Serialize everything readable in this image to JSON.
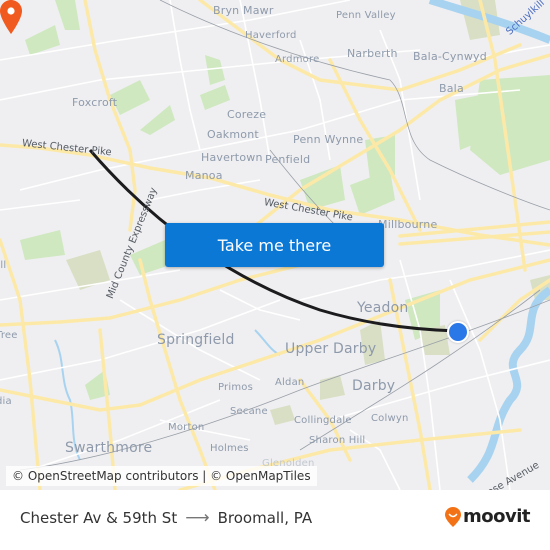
{
  "map": {
    "places": [
      {
        "name": "Bryn Mawr",
        "size": "s10"
      },
      {
        "name": "Penn Valley",
        "size": "s9"
      },
      {
        "name": "Haverford",
        "size": "s9"
      },
      {
        "name": "Ardmore",
        "size": "s9"
      },
      {
        "name": "Narberth",
        "size": "s10"
      },
      {
        "name": "Bala-Cynwyd",
        "size": "s10"
      },
      {
        "name": "Bala",
        "size": "s10"
      },
      {
        "name": "Foxcroft",
        "size": "s10"
      },
      {
        "name": "Coreze",
        "size": "s10"
      },
      {
        "name": "Oakmont",
        "size": "s10"
      },
      {
        "name": "Penn Wynne",
        "size": "s10"
      },
      {
        "name": "Havertown",
        "size": "s10"
      },
      {
        "name": "Penfield",
        "size": "s10"
      },
      {
        "name": "Manoa",
        "size": "s10"
      },
      {
        "name": "Millbourne",
        "size": "s10"
      },
      {
        "name": "Yeadon",
        "size": "s12"
      },
      {
        "name": "Springfield",
        "size": "s12"
      },
      {
        "name": "Upper Darby",
        "size": "s12"
      },
      {
        "name": "Darby",
        "size": "s12"
      },
      {
        "name": "Primos",
        "size": "s9"
      },
      {
        "name": "Aldan",
        "size": "s9"
      },
      {
        "name": "Secane",
        "size": "s9"
      },
      {
        "name": "Collingdale",
        "size": "s9"
      },
      {
        "name": "Colwyn",
        "size": "s9"
      },
      {
        "name": "Morton",
        "size": "s9"
      },
      {
        "name": "Holmes",
        "size": "s9"
      },
      {
        "name": "Sharon Hill",
        "size": "s9"
      },
      {
        "name": "Swarthmore",
        "size": "s12"
      },
      {
        "name": "Glenolden",
        "size": "s9"
      },
      {
        "name": "ell",
        "size": "s9"
      },
      {
        "name": "Tree",
        "size": "s9"
      },
      {
        "name": "dia",
        "size": "s9"
      }
    ],
    "roads": {
      "west_chester_pike_west": "West Chester Pike",
      "west_chester_pike_east": "West Chester Pike",
      "mid_county_expressway": "Mid County Expressway",
      "elmwood_avenue": "rose Avenue"
    },
    "water": {
      "schuylkill": "Schuylkill"
    },
    "origin_marker": {
      "label": "Broomall, PA",
      "color": "#f05a1e",
      "icon": "map-pin-icon"
    },
    "destination_marker": {
      "label": "Chester Av & 59th St",
      "color": "#2a77e8",
      "icon": "location-dot-icon"
    },
    "route_color": "#1c1c1e"
  },
  "cta": {
    "label": "Take me there",
    "color": "#0c78d6"
  },
  "attribution": "© OpenStreetMap contributors | © OpenMapTiles",
  "footer": {
    "from": "Chester Av & 59th St",
    "arrow": "⟶",
    "to": "Broomall, PA",
    "logo_text": "moovit",
    "logo_color": "#f47216"
  }
}
